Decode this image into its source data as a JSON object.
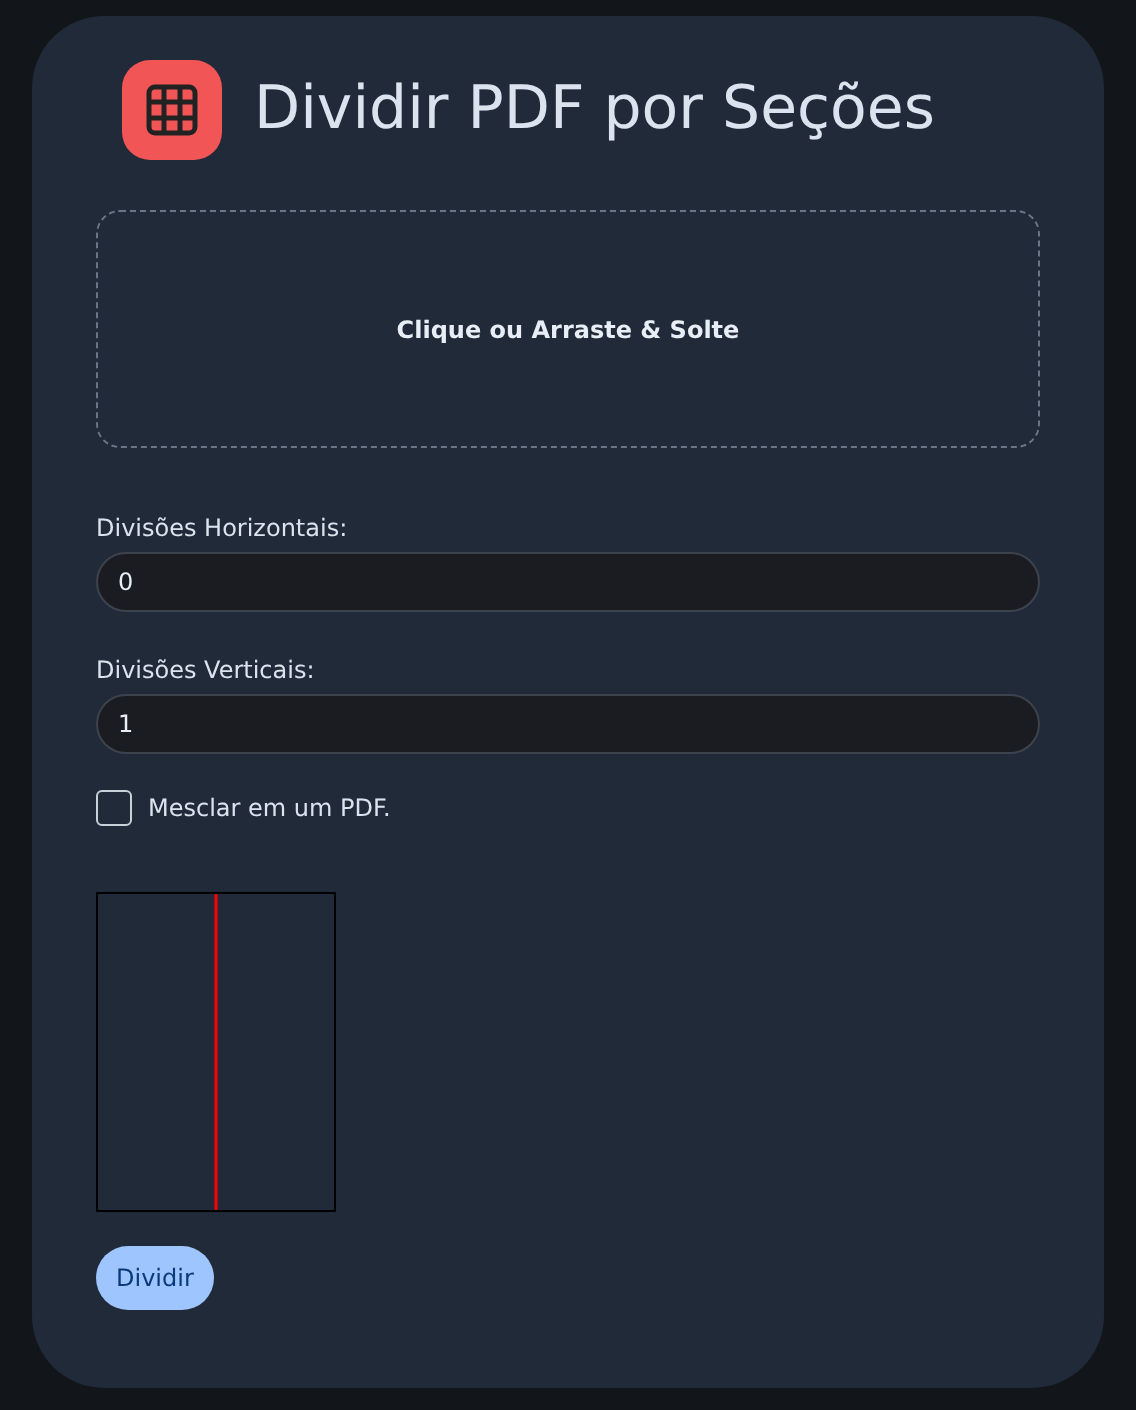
{
  "title": "Dividir PDF por Seções",
  "dropzone": {
    "label": "Clique ou Arraste & Solte"
  },
  "fields": [
    {
      "label": "Divisões Horizontais:",
      "value": "0"
    },
    {
      "label": "Divisões Verticais:",
      "value": "1"
    }
  ],
  "merge": {
    "label": "Mesclar em um PDF.",
    "checked": false
  },
  "button": "Dividir"
}
